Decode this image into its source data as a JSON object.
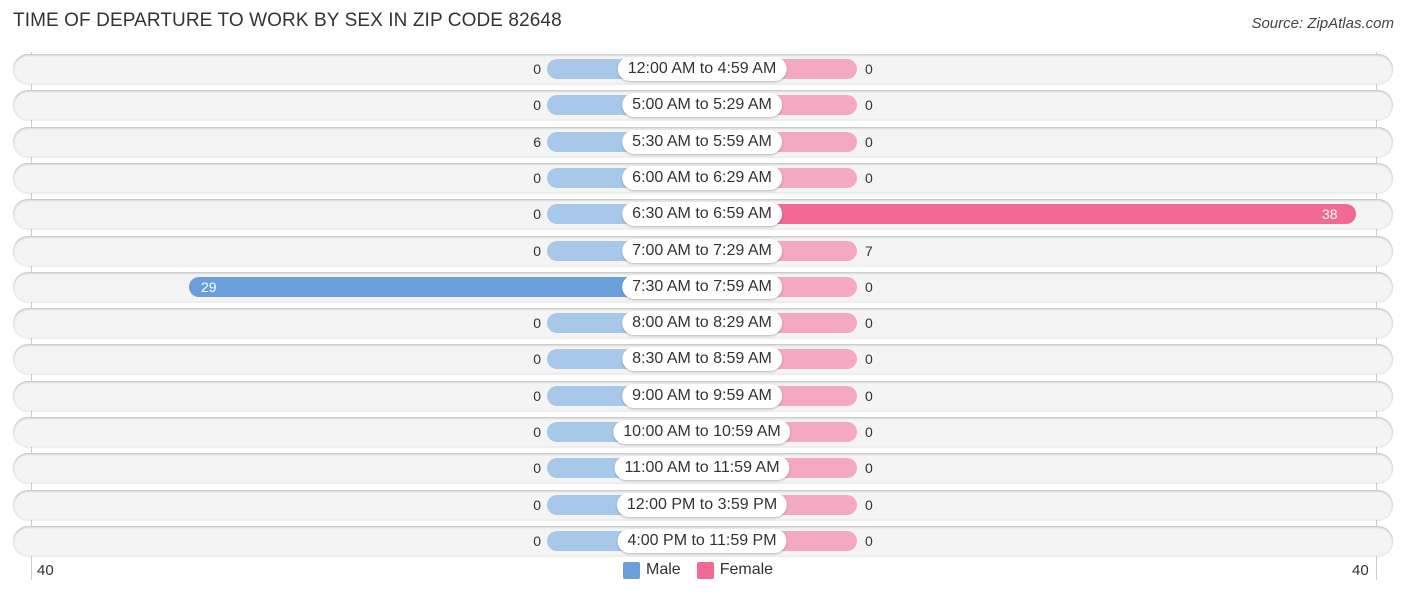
{
  "title": "TIME OF DEPARTURE TO WORK BY SEX IN ZIP CODE 82648",
  "source": "Source: ZipAtlas.com",
  "colors": {
    "male": "#6a9fdb",
    "male_light": "#a8c8ea",
    "female": "#f06a93",
    "female_light": "#f5a8c1"
  },
  "chart_data": {
    "type": "bar",
    "orientation": "horizontal-diverging",
    "title": "TIME OF DEPARTURE TO WORK BY SEX IN ZIP CODE 82648",
    "categories": [
      "12:00 AM to 4:59 AM",
      "5:00 AM to 5:29 AM",
      "5:30 AM to 5:59 AM",
      "6:00 AM to 6:29 AM",
      "6:30 AM to 6:59 AM",
      "7:00 AM to 7:29 AM",
      "7:30 AM to 7:59 AM",
      "8:00 AM to 8:29 AM",
      "8:30 AM to 8:59 AM",
      "9:00 AM to 9:59 AM",
      "10:00 AM to 10:59 AM",
      "11:00 AM to 11:59 AM",
      "12:00 PM to 3:59 PM",
      "4:00 PM to 11:59 PM"
    ],
    "series": [
      {
        "name": "Male",
        "values": [
          0,
          0,
          6,
          0,
          0,
          0,
          29,
          0,
          0,
          0,
          0,
          0,
          0,
          0
        ]
      },
      {
        "name": "Female",
        "values": [
          0,
          0,
          0,
          0,
          38,
          7,
          0,
          0,
          0,
          0,
          0,
          0,
          0,
          0
        ]
      }
    ],
    "xlim": [
      -40,
      40
    ],
    "axis_tick_labels": {
      "left": "40",
      "right": "40"
    },
    "legend": {
      "position": "bottom-center",
      "entries": [
        "Male",
        "Female"
      ]
    }
  }
}
